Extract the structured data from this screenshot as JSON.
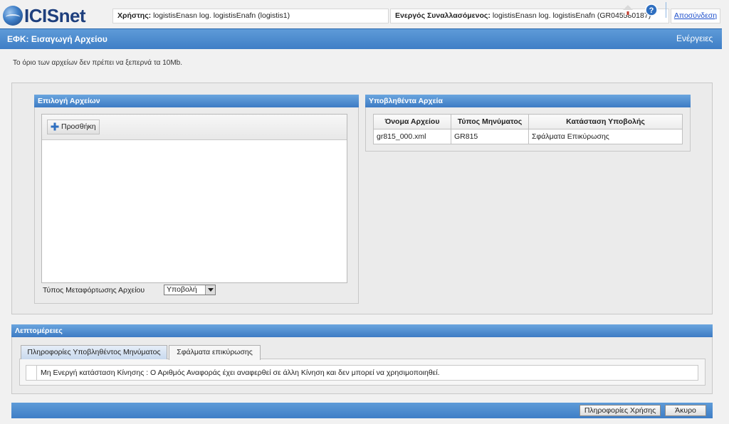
{
  "app": {
    "logo_text": "ICISnet"
  },
  "header": {
    "user_label": "Χρήστης:",
    "user_value": "logistisEnasn log. logistisEnafn (logistis1)",
    "trader_label": "Ενεργός Συναλλασόμενος:",
    "trader_value": "logistisEnasn log. logistisEnafn (GR045580187)",
    "logout": "Αποσύνδεση"
  },
  "titlebar": {
    "title": "ΕΦΚ: Εισαγωγή Αρχείου",
    "actions": "Ενέργειες"
  },
  "notice": "Το όριο των αρχείων δεν πρέπει να ξεπερνά τα 10Mb.",
  "file_selection": {
    "title": "Επιλογή Αρχείων",
    "add_button": "Προσθήκη",
    "upload_type_label": "Τύπος Μεταφόρτωσης Αρχείου",
    "upload_type_value": "Υποβολή"
  },
  "submitted": {
    "title": "Υποβληθέντα Αρχεία",
    "columns": [
      "Όνομα Αρχείου",
      "Τύπος Μηνύματος",
      "Κατάσταση Υποβολής"
    ],
    "rows": [
      [
        "gr815_000.xml",
        "GR815",
        "Σφάλματα Επικύρωσης"
      ]
    ]
  },
  "details": {
    "title": "Λεπτομέρειες",
    "tabs": [
      "Πληροφορίες Υποβληθέντος Μηνύματος",
      "Σφάλματα επικύρωσης"
    ],
    "active_tab": 1,
    "errors": [
      "Μη Ενεργή κατάσταση Κίνησης : Ο Αριθμός Αναφοράς έχει αναφερθεί σε άλλη Κίνηση και δεν μπορεί να χρησιμοποιηθεί."
    ]
  },
  "footer": {
    "help_button": "Πληροφορίες Χρήσης",
    "cancel_button": "Άκυρο"
  },
  "colors": {
    "bar_blue": "#4a88cc",
    "logo_blue": "#1e3f7d",
    "link": "#1c4ecb"
  }
}
